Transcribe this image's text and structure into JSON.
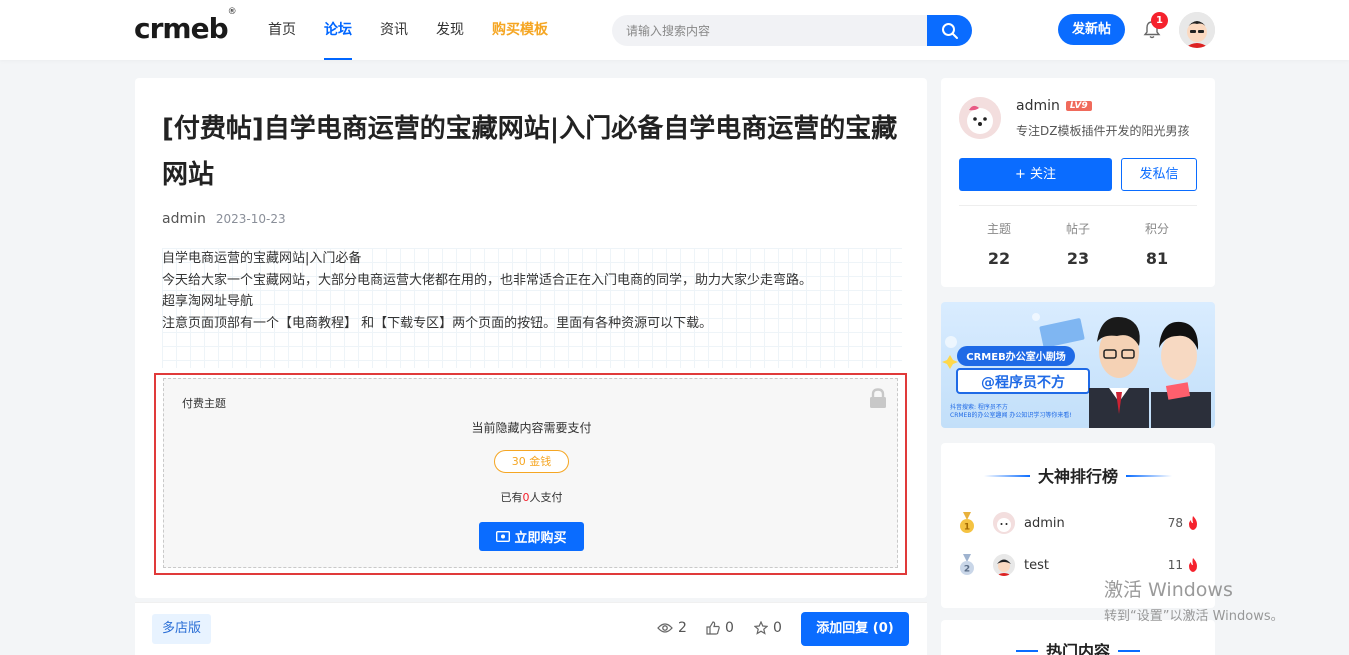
{
  "header": {
    "logo": "crmeb",
    "logo_mark": "®",
    "nav": [
      {
        "label": "首页"
      },
      {
        "label": "论坛"
      },
      {
        "label": "资讯"
      },
      {
        "label": "发现"
      },
      {
        "label": "购买模板"
      }
    ],
    "search_placeholder": "请输入搜索内容",
    "post_button": "发新帖",
    "notification_count": "1"
  },
  "post": {
    "title": "[付费帖]自学电商运营的宝藏网站|入门必备自学电商运营的宝藏网站",
    "author": "admin",
    "date": "2023-10-23",
    "lines": [
      "自学电商运营的宝藏网站|入门必备",
      "今天给大家一个宝藏网站，大部分电商运营大佬都在用的，也非常适合正在入门电商的同学，助力大家少走弯路。",
      "超享淘网址导航",
      "注意页面顶部有一个【电商教程】 和【下载专区】两个页面的按钮。里面有各种资源可以下载。"
    ]
  },
  "paywall": {
    "label": "付费主题",
    "description": "当前隐藏内容需要支付",
    "price": "30 金钱",
    "paid_prefix": "已有",
    "paid_count": "0",
    "paid_suffix": "人支付",
    "buy_button": "立即购买"
  },
  "bottom_bar": {
    "tag": "多店版",
    "views": "2",
    "likes": "0",
    "favorites": "0",
    "reply_button": "添加回复 (0)"
  },
  "profile": {
    "name": "admin",
    "level": "LV9",
    "bio": "专注DZ模板插件开发的阳光男孩",
    "follow_button": "+ 关注",
    "message_button": "发私信",
    "stats": [
      {
        "label": "主题",
        "value": "22"
      },
      {
        "label": "帖子",
        "value": "23"
      },
      {
        "label": "积分",
        "value": "81"
      }
    ]
  },
  "banner": {
    "line1": "CRMEB办公室小剧场",
    "line2": "@程序员不方",
    "line3": "抖音搜索: 程序员不方",
    "line4": "CRMEB的办公室趣闻 办公知识学习等你来看!"
  },
  "ranking": {
    "title": "大神排行榜",
    "rows": [
      {
        "rank": "1",
        "name": "admin",
        "score": "78"
      },
      {
        "rank": "2",
        "name": "test",
        "score": "11"
      }
    ]
  },
  "hot": {
    "title": "热门内容"
  },
  "watermark": {
    "line1": "激活 Windows",
    "line2": "转到“设置”以激活 Windows。"
  }
}
